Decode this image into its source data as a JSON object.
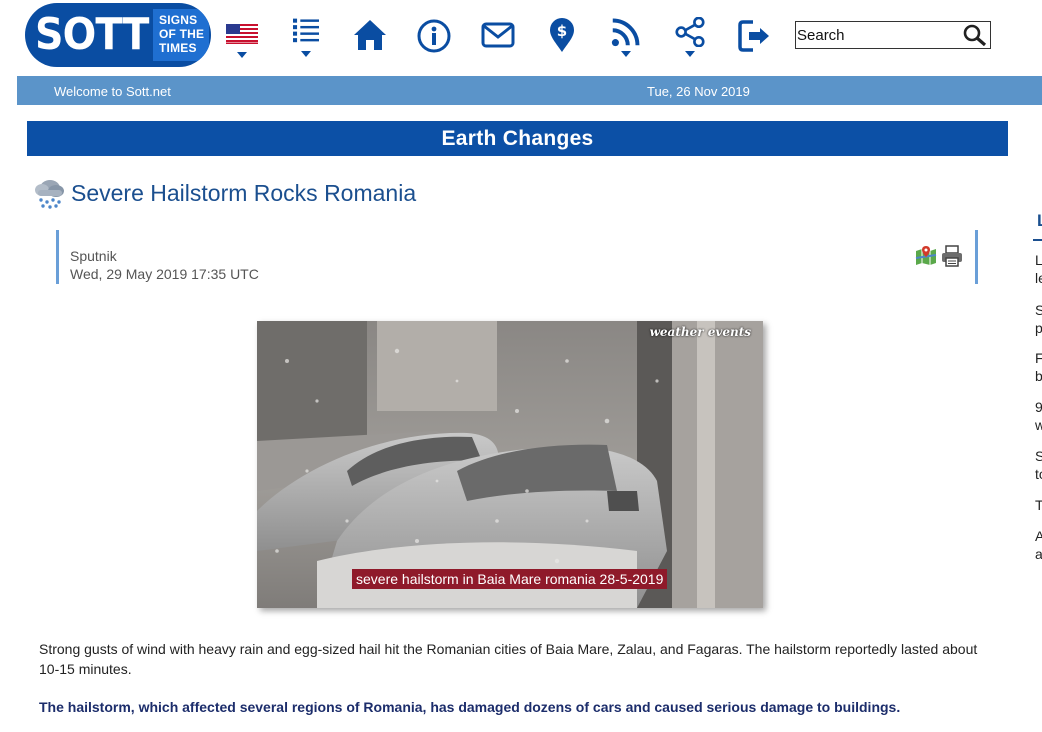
{
  "logo": {
    "wordmark": "SOTT",
    "tagline": [
      "SIGNS",
      "OF THE",
      "TIMES"
    ]
  },
  "nav": {
    "icons": [
      "us-flag-icon",
      "list-icon",
      "home-icon",
      "info-icon",
      "mail-icon",
      "donate-icon",
      "rss-icon",
      "share-icon",
      "login-icon"
    ]
  },
  "search": {
    "placeholder": "Search"
  },
  "infobar": {
    "welcome": "Welcome to Sott.net",
    "date": "Tue, 26 Nov 2019"
  },
  "section": {
    "title": "Earth Changes"
  },
  "article": {
    "title": "Severe Hailstorm Rocks Romania",
    "source": "Sputnik",
    "date": "Wed, 29 May 2019 17:35 UTC",
    "image": {
      "watermark": "weather events",
      "caption": "severe hailstorm in Baia Mare romania 28-5-2019"
    },
    "paragraphs": [
      "Strong gusts of wind with heavy rain and egg-sized hail hit the Romanian cities of Baia Mare, Zalau, and Fagaras. The hailstorm reportedly lasted about 10-15 minutes.",
      "The hailstorm, which affected several regions of Romania, has damaged dozens of cars and caused serious damage to buildings."
    ]
  },
  "sidebar": {
    "heading": "L",
    "items": [
      {
        "line1": "L",
        "line2": "le"
      },
      {
        "line1": "S",
        "line2": "p"
      },
      {
        "line1": "F",
        "line2": "b"
      },
      {
        "line1": "9",
        "line2": "w"
      },
      {
        "line1": "S",
        "line2": "to"
      },
      {
        "line1": "T",
        "line2": ""
      },
      {
        "line1": "A",
        "line2": "a"
      }
    ]
  },
  "colors": {
    "brand_blue": "#0a4da2",
    "infobar": "#5b94c9",
    "section_bar": "#0c50a6",
    "title_text": "#1b4f8f",
    "caption_bg": "#8f1a2a",
    "bold_text": "#1c2d6b"
  }
}
